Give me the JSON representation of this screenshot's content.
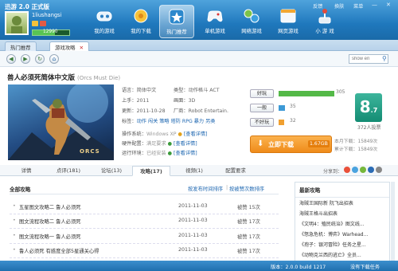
{
  "window": {
    "title": "迅游 2.0 正式版",
    "controls": [
      "反馈",
      "换肤",
      "菜单"
    ]
  },
  "user": {
    "name": "1liushangsi",
    "coins": "12990"
  },
  "nav": [
    {
      "label": "我的游戏",
      "icon": "gamepad-icon"
    },
    {
      "label": "我的下载",
      "icon": "gear-icon"
    },
    {
      "label": "热门推荐",
      "icon": "star-icon"
    },
    {
      "label": "单机游戏",
      "icon": "controller-icon"
    },
    {
      "label": "网络游戏",
      "icon": "network-icon"
    },
    {
      "label": "网页游戏",
      "icon": "browser-icon"
    },
    {
      "label": "小 游 戏",
      "icon": "joystick-icon"
    }
  ],
  "tabs": [
    "热门推荐",
    "游戏攻略"
  ],
  "search": {
    "placeholder": "show en"
  },
  "game": {
    "title": "兽人必须死简体中文版",
    "subtitle": "(Orcs Must Die)",
    "language_label": "语言：",
    "language": "简体中文",
    "size_label": "上手：",
    "size": "2011",
    "updated_label": "更新：",
    "updated": "2011-10-28",
    "tags_label": "标签：",
    "tags": "动作 闯关 策略 塔防 RPG 暴力 另类",
    "type_label": "类型：",
    "type": "动作格斗 ACT",
    "screen_label": "画面：",
    "screen": "3D",
    "vendor_label": "厂商：",
    "vendor": "Robot Entertain.",
    "os_label": "操作系统：",
    "os": "Windows XP",
    "hw_label": "硬件配置：",
    "hw": "满足要求",
    "env_label": "运行环境：",
    "env": "已经安装",
    "view_detail": "[查看详情]",
    "hero_art_caption": "ORCS"
  },
  "votes": [
    {
      "label": "好玩",
      "count": "305",
      "ratio": 0.85,
      "color": "#54b948"
    },
    {
      "label": "一般",
      "count": "35",
      "ratio": 0.1,
      "color": "#3d9ad6"
    },
    {
      "label": "不好玩",
      "count": "32",
      "ratio": 0.09,
      "color": "#f0a030"
    }
  ],
  "score": {
    "big": "8",
    "decimal": ".7",
    "votes": "372人投票"
  },
  "download": {
    "label": "立即下载",
    "size": "1.67GB",
    "week_label": "本月下载：",
    "week": "15849次",
    "total_label": "累计下载：",
    "total": "15849次"
  },
  "subtabs": [
    "详情",
    "点评(181)",
    "论坛(13)",
    "攻略(17)",
    "视频(1)",
    "配置要求"
  ],
  "share_label": "分享到：",
  "guides": {
    "header": "全部攻略",
    "sort_time": "按发布时间排序",
    "sort_hot": "按被赞次数排序",
    "rows": [
      {
        "title": "五星图文攻略二 鲁人必须死",
        "date": "2011-11-03",
        "likes": "被赞 15次"
      },
      {
        "title": "图文流程攻略二 鲁人必须死",
        "date": "2011-11-03",
        "likes": "被赞 17次"
      },
      {
        "title": "图文流程攻略一 鲁人必须死",
        "date": "2011-11-03",
        "likes": "被赞 17次"
      },
      {
        "title": "鲁人必须死 有感度全部5星通关心得",
        "date": "2011-11-03",
        "likes": "被赞 17次"
      }
    ]
  },
  "latest": {
    "header": "最新攻略",
    "items": [
      "海贼王国际新 阮飞出招表",
      "海贼王格斗出招表",
      "《文明4：殖民统治》图文线...",
      "《怒急危机：博弈》Warhead...",
      "《孢子：银河冒险》任务之星...",
      "《动物克兰西的逃亡》全员..."
    ]
  },
  "status": {
    "version": "版本：2.0.0 build 1217",
    "tasks": "没有下载任务"
  }
}
